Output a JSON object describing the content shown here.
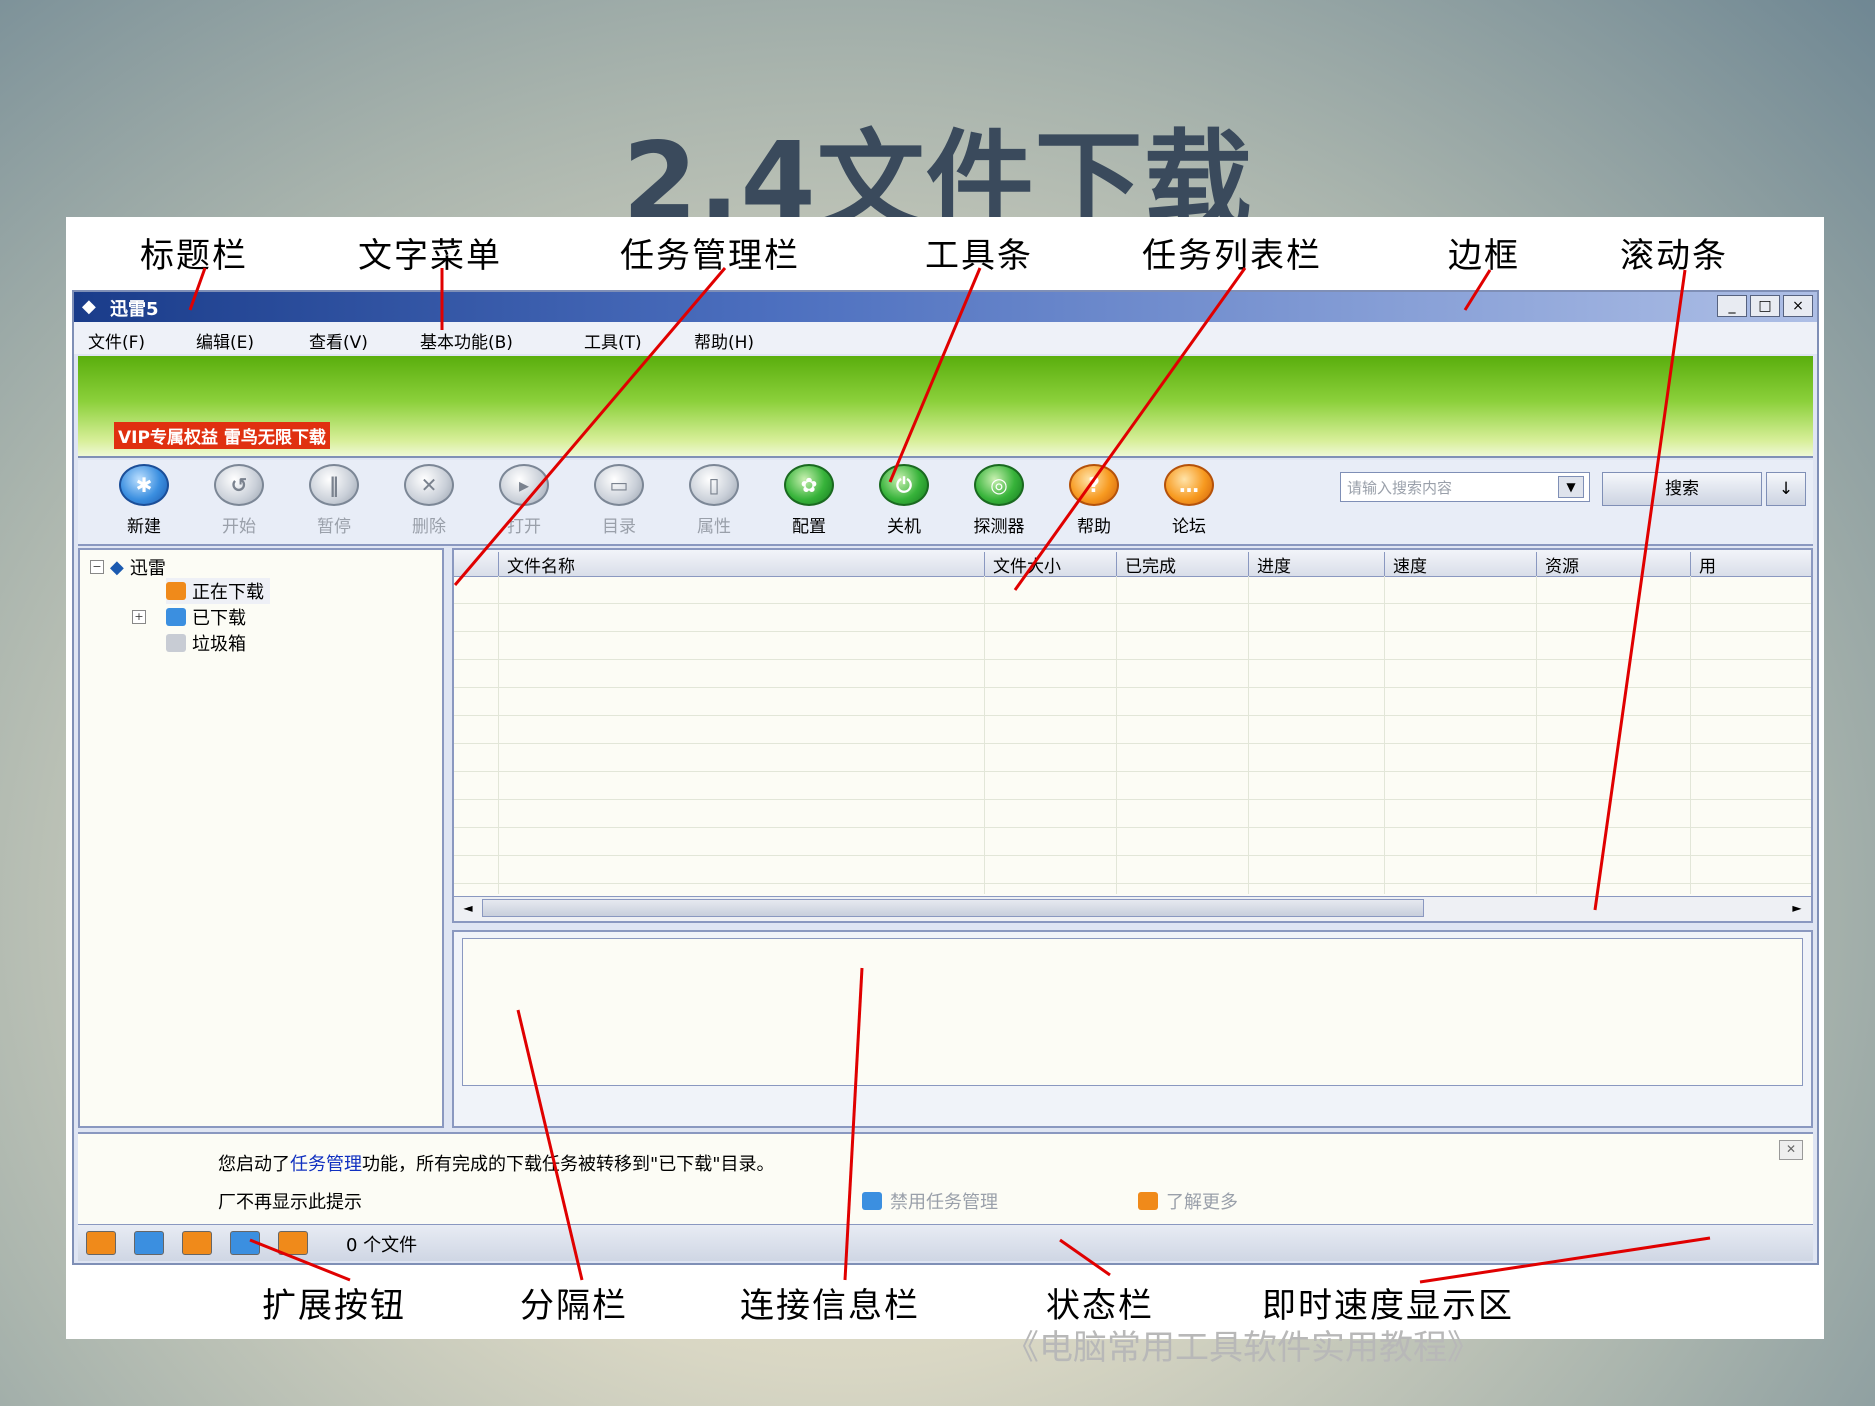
{
  "slide": {
    "title": "2.4文件下载",
    "footer": "《电脑常用工具软件实用教程》"
  },
  "callouts_top": [
    "标题栏",
    "文字菜单",
    "任务管理栏",
    "工具条",
    "任务列表栏",
    "边框",
    "滚动条"
  ],
  "callouts_bottom": [
    "扩展按钮",
    "分隔栏",
    "连接信息栏",
    "状态栏",
    "即时速度显示区"
  ],
  "window": {
    "title": "迅雷5",
    "controls": [
      "_",
      "□",
      "×"
    ]
  },
  "menu": [
    "文件(F)",
    "编辑(E)",
    "查看(V)",
    "基本功能(B)",
    "工具(T)",
    "帮助(H)"
  ],
  "banner": {
    "promo": "VIP专属权益 雷鸟无限下载"
  },
  "toolbar": {
    "buttons": [
      {
        "label": "新建",
        "icon": "star-icon",
        "state": "enabled"
      },
      {
        "label": "开始",
        "icon": "start-icon",
        "state": "disabled"
      },
      {
        "label": "暂停",
        "icon": "pause-icon",
        "state": "disabled"
      },
      {
        "label": "删除",
        "icon": "delete-icon",
        "state": "disabled"
      },
      {
        "label": "打开",
        "icon": "open-icon",
        "state": "disabled"
      },
      {
        "label": "目录",
        "icon": "folder-icon",
        "state": "disabled"
      },
      {
        "label": "属性",
        "icon": "properties-icon",
        "state": "disabled"
      },
      {
        "label": "配置",
        "icon": "config-icon",
        "state": "enabled"
      },
      {
        "label": "关机",
        "icon": "shutdown-icon",
        "state": "enabled"
      },
      {
        "label": "探测器",
        "icon": "probe-icon",
        "state": "enabled"
      },
      {
        "label": "帮助",
        "icon": "help-icon",
        "state": "enabled"
      },
      {
        "label": "论坛",
        "icon": "forum-icon",
        "state": "enabled"
      }
    ],
    "search_placeholder": "请输入搜索内容",
    "search_button": "搜索",
    "search_more": "↓"
  },
  "tree": {
    "root": "迅雷",
    "items": [
      "正在下载",
      "已下载",
      "垃圾箱"
    ]
  },
  "list": {
    "columns": [
      "文件名称",
      "文件大小",
      "已完成",
      "进度",
      "速度",
      "资源",
      "用"
    ]
  },
  "notice": {
    "msg_prefix": "您启动了",
    "msg_link": "任务管理",
    "msg_suffix": "功能，所有完成的下载任务被转移到\"已下载\"目录。",
    "checkbox": "厂不再显示此提示",
    "action_disable": "禁用任务管理",
    "action_more": "了解更多"
  },
  "status": {
    "count": "0 个文件"
  },
  "colors": {
    "accent_red": "#e00000",
    "title_blue": "#1a3c8a",
    "banner_green": "#5aae0d"
  }
}
